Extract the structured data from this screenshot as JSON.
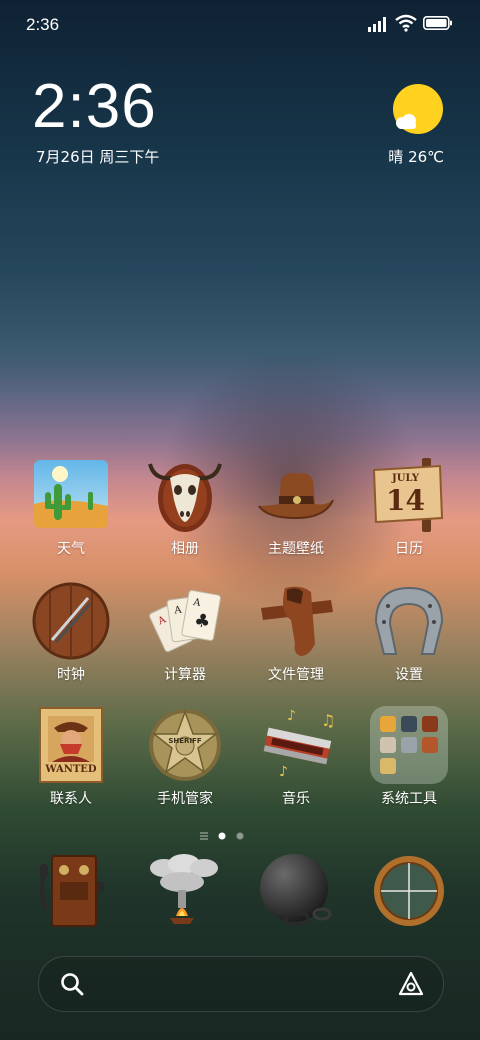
{
  "status_bar": {
    "time": "2:36"
  },
  "widget": {
    "clock": "2:36",
    "date": "7月26日 周三下午",
    "weather": "晴 26℃",
    "weather_icon": "sunny-cloud-icon"
  },
  "apps": [
    {
      "label": "天气",
      "icon": "desert-cactus-icon"
    },
    {
      "label": "相册",
      "icon": "bull-skull-icon"
    },
    {
      "label": "主题壁纸",
      "icon": "cowboy-hat-icon"
    },
    {
      "label": "日历",
      "icon": "wooden-sign-icon"
    },
    {
      "label": "时钟",
      "icon": "wooden-shield-icon"
    },
    {
      "label": "计算器",
      "icon": "playing-cards-icon"
    },
    {
      "label": "文件管理",
      "icon": "gun-holster-icon"
    },
    {
      "label": "设置",
      "icon": "horseshoe-icon"
    },
    {
      "label": "联系人",
      "icon": "wanted-poster-icon"
    },
    {
      "label": "手机管家",
      "icon": "sheriff-badge-icon"
    },
    {
      "label": "音乐",
      "icon": "harmonica-icon"
    },
    {
      "label": "系统工具",
      "icon": "folder-icon"
    }
  ],
  "calendar_icon_text": {
    "month": "JULY",
    "day": "14"
  },
  "badge_text": "SHERIFF",
  "poster_text": "WANTED",
  "page_indicator": {
    "count": 2,
    "active": 0
  },
  "dock": [
    {
      "icon": "wall-telephone-icon"
    },
    {
      "icon": "smoke-signal-icon"
    },
    {
      "icon": "ball-and-chain-icon"
    },
    {
      "icon": "scope-crosshair-icon"
    }
  ],
  "colors": {
    "sun": "#ffd21f",
    "wood": "#8a4a22",
    "gold": "#c9a048"
  }
}
